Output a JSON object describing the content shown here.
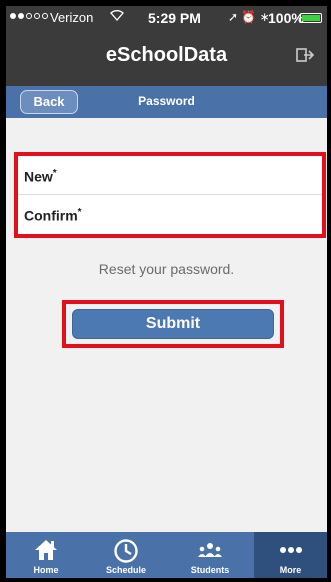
{
  "status": {
    "carrier": "Verizon",
    "time": "5:29 PM",
    "battery": "100%"
  },
  "header": {
    "title": "eSchoolData",
    "logout_icon": "logout-icon"
  },
  "nav": {
    "back_label": "Back",
    "title": "Password"
  },
  "form": {
    "new_label": "New",
    "confirm_label": "Confirm",
    "required_mark": "*",
    "new_value": "",
    "confirm_value": ""
  },
  "hint": "Reset your password.",
  "submit_label": "Submit",
  "tabs": [
    {
      "label": "Home",
      "icon": "home-icon"
    },
    {
      "label": "Schedule",
      "icon": "clock-icon"
    },
    {
      "label": "Students",
      "icon": "students-icon"
    },
    {
      "label": "More",
      "icon": "more-icon",
      "active": true
    }
  ],
  "colors": {
    "header_bg": "#3b3b3b",
    "accent": "#4a72a8",
    "highlight": "#e2101d"
  }
}
